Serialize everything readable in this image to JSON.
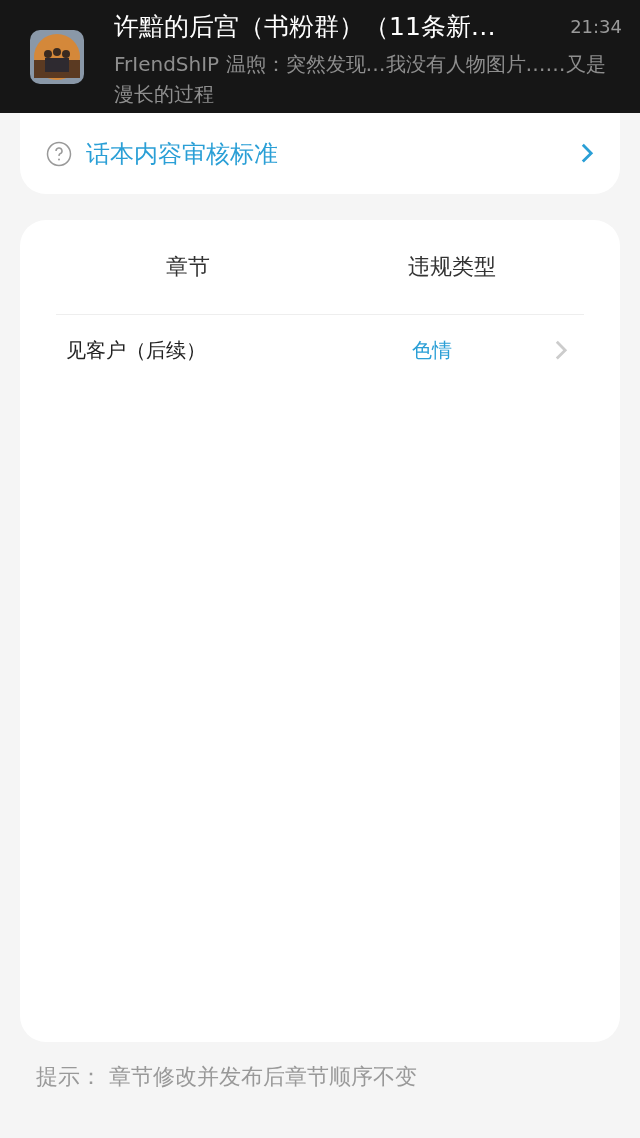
{
  "notification": {
    "title": "许黯的后宫（书粉群）（11条新…",
    "time": "21:34",
    "message": "FrIendShIP  温煦：突然发现…我没有人物图片……又是漫长的过程"
  },
  "guideline_link": {
    "label": "话本内容审核标准"
  },
  "table": {
    "columns": [
      "章节",
      "违规类型"
    ],
    "rows": [
      {
        "chapter": "见客户（后续）",
        "violation": "色情"
      }
    ]
  },
  "hint": "提示：  章节修改并发布后章节顺序不变"
}
